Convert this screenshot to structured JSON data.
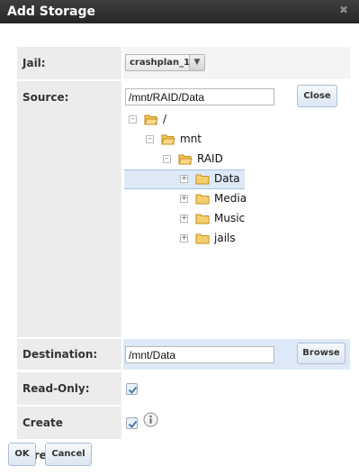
{
  "dialog": {
    "title": "Add Storage"
  },
  "form": {
    "jail": {
      "label": "Jail:",
      "value": "crashplan_1"
    },
    "source": {
      "label": "Source:",
      "value": "/mnt/RAID/Data",
      "close_label": "Close",
      "tree": [
        {
          "label": "/",
          "expanded": true
        },
        {
          "label": "mnt",
          "expanded": true
        },
        {
          "label": "RAID",
          "expanded": true
        },
        {
          "label": "Data",
          "selected": true
        },
        {
          "label": "Media"
        },
        {
          "label": "Music"
        },
        {
          "label": "jails"
        }
      ]
    },
    "destination": {
      "label": "Destination:",
      "value": "/mnt/Data",
      "browse_label": "Browse"
    },
    "read_only": {
      "label": "Read-Only:",
      "checked": true
    },
    "create_directory": {
      "label": "Create directory:",
      "checked": true
    }
  },
  "actions": {
    "ok_label": "OK",
    "cancel_label": "Cancel"
  },
  "colors": {
    "title_bar": "#2f2f2f",
    "label_bg": "#ececec",
    "selection": "#dde9f7",
    "folder": "#f0c35a"
  }
}
